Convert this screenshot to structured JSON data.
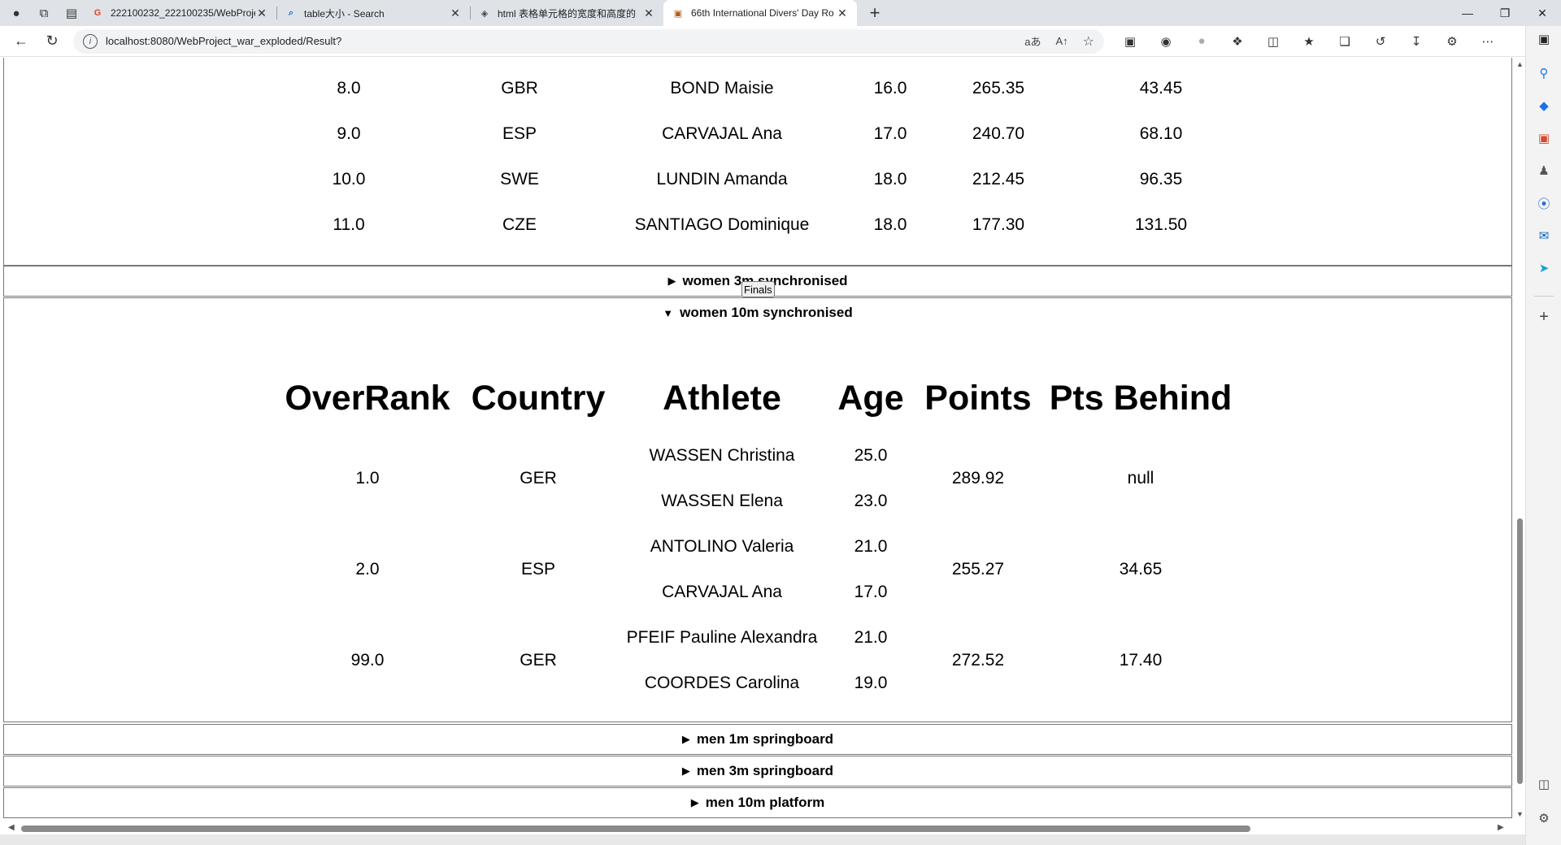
{
  "browser": {
    "tabs": [
      {
        "title": "222100232_222100235/WebProje",
        "favicon": "G",
        "favicon_color": "#e0452f",
        "active": false
      },
      {
        "title": "table大小 - Search",
        "favicon": "⌕",
        "favicon_color": "#1a73e8",
        "active": false
      },
      {
        "title": "html 表格单元格的宽度和高度的",
        "favicon": "◈",
        "favicon_color": "#444444",
        "active": false
      },
      {
        "title": "66th International Divers' Day Ro",
        "favicon": "▣",
        "favicon_color": "#b35a1f",
        "active": true
      }
    ],
    "new_tab_label": "+",
    "address_url": "localhost:8080/WebProject_war_exploded/Result?",
    "read_aloud_icon": "aあ",
    "text_size_icon": "A↑"
  },
  "results": {
    "top_rows": [
      {
        "rank": "8.0",
        "country": "GBR",
        "athlete": "BOND Maisie",
        "age": "16.0",
        "points": "265.35",
        "behind": "43.45"
      },
      {
        "rank": "9.0",
        "country": "ESP",
        "athlete": "CARVAJAL Ana",
        "age": "17.0",
        "points": "240.70",
        "behind": "68.10"
      },
      {
        "rank": "10.0",
        "country": "SWE",
        "athlete": "LUNDIN Amanda",
        "age": "18.0",
        "points": "212.45",
        "behind": "96.35"
      },
      {
        "rank": "11.0",
        "country": "CZE",
        "athlete": "SANTIAGO Dominique",
        "age": "18.0",
        "points": "177.30",
        "behind": "131.50"
      }
    ],
    "events": {
      "w3m_sync": {
        "label": "women 3m synchronised",
        "expanded": false
      },
      "w10m_sync": {
        "label": "women 10m synchronised",
        "expanded": true
      },
      "m1m": {
        "label": "men 1m springboard",
        "expanded": false
      },
      "m3m": {
        "label": "men 3m springboard",
        "expanded": false
      },
      "m10m": {
        "label": "men 10m platform",
        "expanded": false
      }
    },
    "finals_button": "Finals",
    "headers": {
      "rank": "OverRank",
      "country": "Country",
      "athlete": "Athlete",
      "age": "Age",
      "points": "Points",
      "behind": "Pts Behind"
    },
    "sync_rows": [
      {
        "rank": "1.0",
        "country": "GER",
        "athlete1": "WASSEN Christina",
        "age1": "25.0",
        "athlete2": "WASSEN Elena",
        "age2": "23.0",
        "points": "289.92",
        "behind": "null"
      },
      {
        "rank": "2.0",
        "country": "ESP",
        "athlete1": "ANTOLINO Valeria",
        "age1": "21.0",
        "athlete2": "CARVAJAL Ana",
        "age2": "17.0",
        "points": "255.27",
        "behind": "34.65"
      },
      {
        "rank": "99.0",
        "country": "GER",
        "athlete1": "PFEIF Pauline Alexandra",
        "age1": "21.0",
        "athlete2": "COORDES Carolina",
        "age2": "19.0",
        "points": "272.52",
        "behind": "17.40"
      }
    ]
  }
}
